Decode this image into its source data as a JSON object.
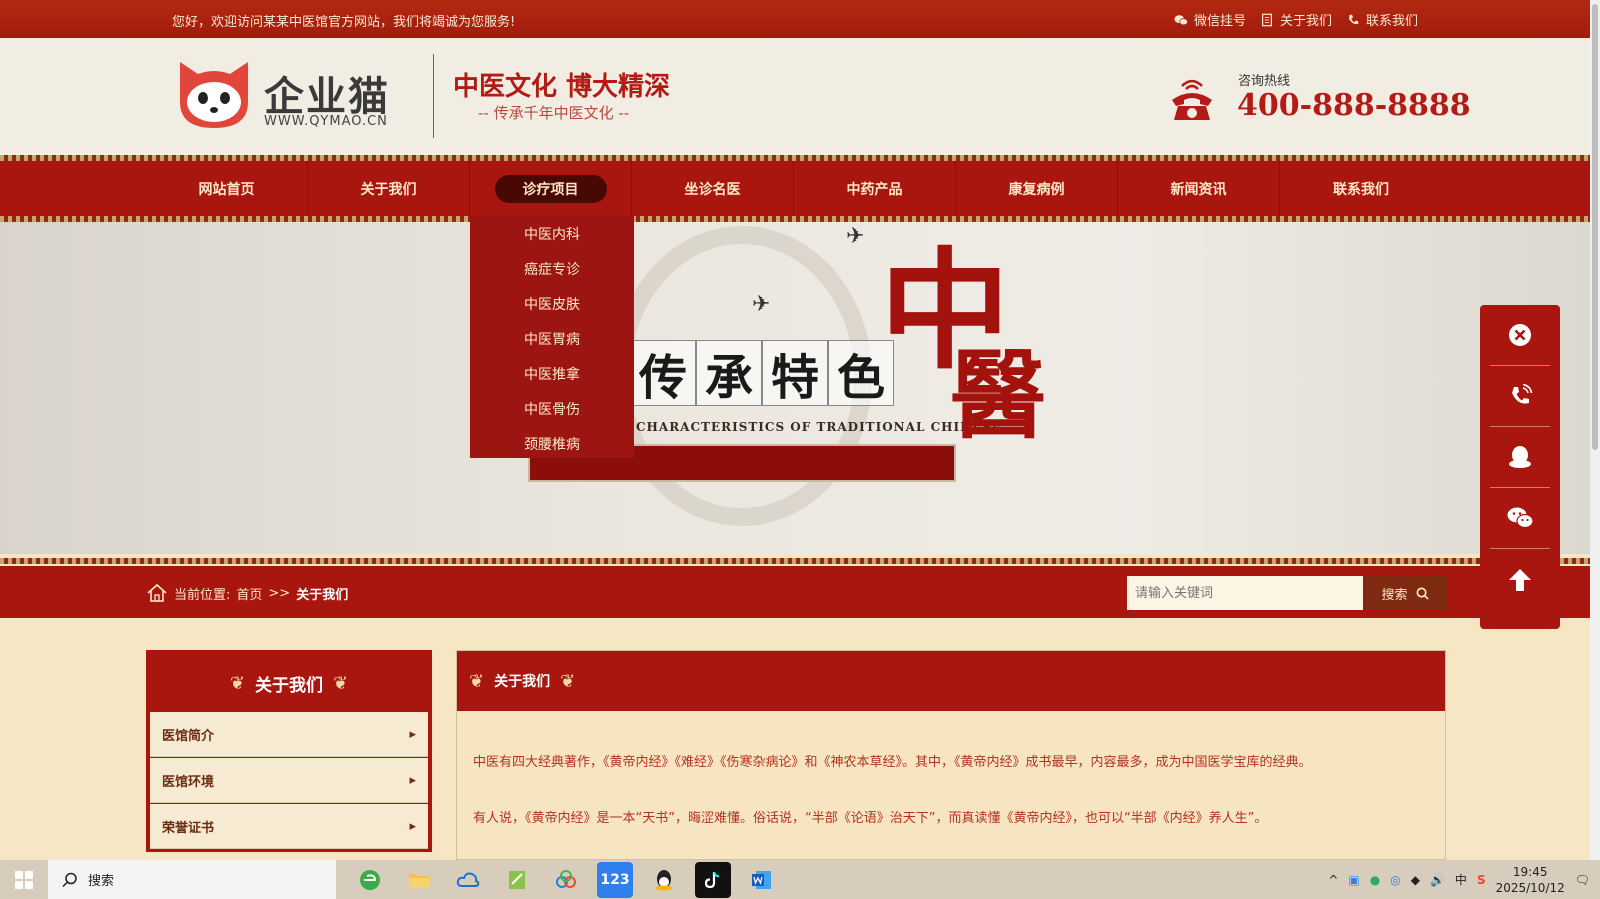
{
  "topbar": {
    "welcome": "您好，欢迎访问某某中医馆官方网站，我们将竭诚为您服务!",
    "links": [
      "微信挂号",
      "关于我们",
      "联系我们"
    ]
  },
  "header": {
    "logo_brand": "企业猫",
    "logo_url": "WWW.QYMAO.CN",
    "slogan_main": "中医文化 博大精深",
    "slogan_sub": "-- 传承千年中医文化 --",
    "hotline_label": "咨询热线",
    "hotline_number": "400-888-8888"
  },
  "nav": {
    "items": [
      "网站首页",
      "关于我们",
      "诊疗项目",
      "坐诊名医",
      "中药产品",
      "康复病例",
      "新闻资讯",
      "联系我们"
    ],
    "active_index": 2,
    "dropdown": [
      "中医内科",
      "癌症专诊",
      "中医皮肤",
      "中医胃病",
      "中医推拿",
      "中医骨伤",
      "颈腰椎病"
    ]
  },
  "banner": {
    "motto": [
      "传",
      "承",
      "特",
      "色"
    ],
    "english": "CHARACTERISTICS OF TRADITIONAL CHINESE",
    "big_char_1": "中",
    "big_char_2": "醫"
  },
  "breadcrumb": {
    "label": "当前位置:",
    "home": "首页",
    "sep": ">>",
    "current": "关于我们"
  },
  "search": {
    "placeholder": "请输入关键词",
    "button": "搜索"
  },
  "sidebar": {
    "title": "关于我们",
    "items": [
      "医馆简介",
      "医馆环境",
      "荣誉证书"
    ]
  },
  "main": {
    "title": "关于我们",
    "paragraphs": [
      "中医有四大经典著作，《黄帝内经》《难经》《伤寒杂病论》和《神农本草经》。其中，《黄帝内经》成书最早，内容最多，成为中国医学宝库的经典。",
      "有人说，《黄帝内经》是一本“天书”，晦涩难懂。俗话说，“半部《论语》治天下”，而真读懂《黄帝内经》，也可以“半部《内经》养人生”。"
    ]
  },
  "floatbar": [
    "close-icon",
    "phone-icon",
    "qq-icon",
    "wechat-icon",
    "arrow-up-icon"
  ],
  "taskbar": {
    "search_label": "搜索",
    "app_123": "123",
    "ime": "中",
    "time": "19:45",
    "date": "2025/10/12"
  },
  "colors": {
    "primary_red": "#a8160f",
    "header_bg": "#f2ede3",
    "page_bg": "#f6e6c4"
  }
}
